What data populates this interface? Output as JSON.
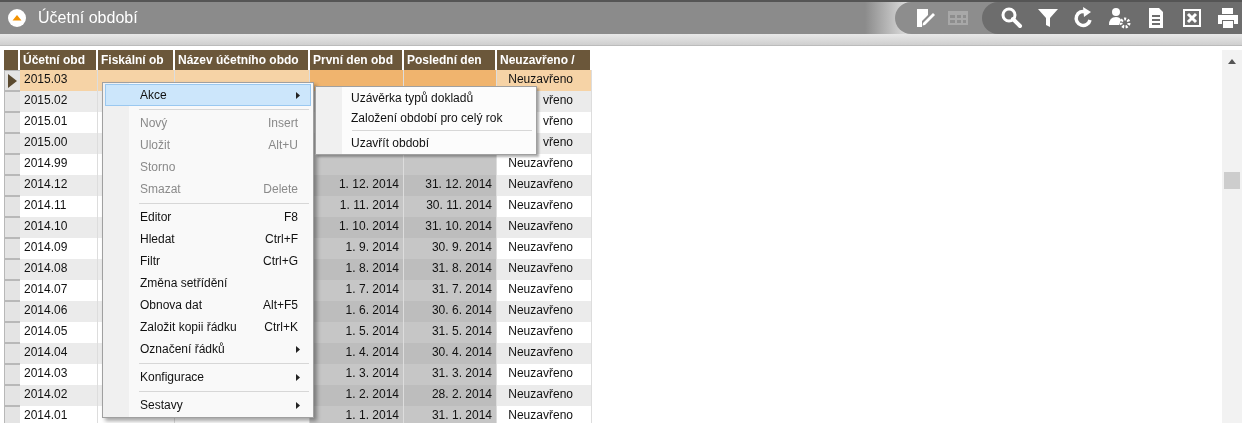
{
  "window": {
    "title": "Účetní období"
  },
  "toolbar": [
    {
      "kind": "edit",
      "disabled": false
    },
    {
      "kind": "grid",
      "disabled": true
    },
    {
      "kind": "search",
      "disabled": false
    },
    {
      "kind": "filter",
      "disabled": false
    },
    {
      "kind": "refresh",
      "disabled": false
    },
    {
      "kind": "user-settings",
      "disabled": false
    },
    {
      "kind": "document",
      "disabled": false
    },
    {
      "kind": "excel",
      "disabled": false
    },
    {
      "kind": "print",
      "disabled": false
    }
  ],
  "table": {
    "columns": [
      "Účetní obd",
      "Fiskální ob",
      "Název účetního obdo",
      "První den obd",
      "Poslední den",
      "Neuzavřeno /"
    ],
    "rows": [
      {
        "selected": true,
        "cells": [
          "2015.03",
          null,
          null,
          null,
          null,
          "Neuzavřeno"
        ]
      },
      {
        "selected": false,
        "cells": [
          "2015.02",
          null,
          null,
          null,
          null,
          "vřeno"
        ]
      },
      {
        "selected": false,
        "cells": [
          "2015.01",
          null,
          null,
          null,
          null,
          "vřeno"
        ]
      },
      {
        "selected": false,
        "cells": [
          "2015.00",
          null,
          null,
          null,
          null,
          "vřeno"
        ]
      },
      {
        "selected": false,
        "cells": [
          "2014.99",
          null,
          null,
          null,
          null,
          "Neuzavřeno"
        ]
      },
      {
        "selected": false,
        "cells": [
          "2014.12",
          null,
          null,
          "1. 12. 2014",
          "31. 12. 2014",
          "Neuzavřeno"
        ]
      },
      {
        "selected": false,
        "cells": [
          "2014.11",
          null,
          null,
          "1. 11. 2014",
          "30. 11. 2014",
          "Neuzavřeno"
        ]
      },
      {
        "selected": false,
        "cells": [
          "2014.10",
          null,
          null,
          "1. 10. 2014",
          "31. 10. 2014",
          "Neuzavřeno"
        ]
      },
      {
        "selected": false,
        "cells": [
          "2014.09",
          null,
          null,
          "1. 9. 2014",
          "30. 9. 2014",
          "Neuzavřeno"
        ]
      },
      {
        "selected": false,
        "cells": [
          "2014.08",
          null,
          null,
          "1. 8. 2014",
          "31. 8. 2014",
          "Neuzavřeno"
        ]
      },
      {
        "selected": false,
        "cells": [
          "2014.07",
          null,
          null,
          "1. 7. 2014",
          "31. 7. 2014",
          "Neuzavřeno"
        ]
      },
      {
        "selected": false,
        "cells": [
          "2014.06",
          null,
          null,
          "1. 6. 2014",
          "30. 6. 2014",
          "Neuzavřeno"
        ]
      },
      {
        "selected": false,
        "cells": [
          "2014.05",
          null,
          null,
          "1. 5. 2014",
          "31. 5. 2014",
          "Neuzavřeno"
        ]
      },
      {
        "selected": false,
        "cells": [
          "2014.04",
          null,
          null,
          "1. 4. 2014",
          "30. 4. 2014",
          "Neuzavřeno"
        ]
      },
      {
        "selected": false,
        "cells": [
          "2014.03",
          null,
          null,
          "1. 3. 2014",
          "31. 3. 2014",
          "Neuzavřeno"
        ]
      },
      {
        "selected": false,
        "cells": [
          "2014.02",
          null,
          null,
          "1. 2. 2014",
          "28. 2. 2014",
          "Neuzavřeno"
        ]
      },
      {
        "selected": false,
        "cells": [
          "2014.01",
          null,
          null,
          "1. 1. 2014",
          "31. 1. 2014",
          "Neuzavřeno"
        ]
      }
    ]
  },
  "context_menu": {
    "items": [
      {
        "kind": "item",
        "label": "Akce",
        "highlighted": true,
        "disabled": false,
        "submenu": true
      },
      {
        "kind": "separator"
      },
      {
        "kind": "item",
        "label": "Nový",
        "shortcut": "Insert",
        "highlighted": false,
        "disabled": true,
        "submenu": false
      },
      {
        "kind": "item",
        "label": "Uložit",
        "shortcut": "Alt+U",
        "highlighted": false,
        "disabled": true,
        "submenu": false
      },
      {
        "kind": "item",
        "label": "Storno",
        "highlighted": false,
        "disabled": true,
        "submenu": false
      },
      {
        "kind": "item",
        "label": "Smazat",
        "shortcut": "Delete",
        "highlighted": false,
        "disabled": true,
        "submenu": false
      },
      {
        "kind": "separator"
      },
      {
        "kind": "item",
        "label": "Editor",
        "shortcut": "F8",
        "highlighted": false,
        "disabled": false,
        "submenu": false
      },
      {
        "kind": "item",
        "label": "Hledat",
        "shortcut": "Ctrl+F",
        "highlighted": false,
        "disabled": false,
        "submenu": false
      },
      {
        "kind": "item",
        "label": "Filtr",
        "shortcut": "Ctrl+G",
        "highlighted": false,
        "disabled": false,
        "submenu": false
      },
      {
        "kind": "item",
        "label": "Změna setřídění",
        "highlighted": false,
        "disabled": false,
        "submenu": false
      },
      {
        "kind": "item",
        "label": "Obnova dat",
        "shortcut": "Alt+F5",
        "highlighted": false,
        "disabled": false,
        "submenu": false
      },
      {
        "kind": "item",
        "label": "Založit kopii řádku",
        "shortcut": "Ctrl+K",
        "highlighted": false,
        "disabled": false,
        "submenu": false
      },
      {
        "kind": "item",
        "label": "Označení řádků",
        "highlighted": false,
        "disabled": false,
        "submenu": true
      },
      {
        "kind": "separator"
      },
      {
        "kind": "item",
        "label": "Konfigurace",
        "highlighted": false,
        "disabled": false,
        "submenu": true
      },
      {
        "kind": "separator"
      },
      {
        "kind": "item",
        "label": "Sestavy",
        "highlighted": false,
        "disabled": false,
        "submenu": true
      }
    ]
  },
  "submenu": {
    "items": [
      {
        "kind": "item",
        "label": "Uzávěrka typů dokladů"
      },
      {
        "kind": "item",
        "label": "Založení období pro celý rok"
      },
      {
        "kind": "separator"
      },
      {
        "kind": "item",
        "label": "Uzavřít období"
      }
    ]
  }
}
